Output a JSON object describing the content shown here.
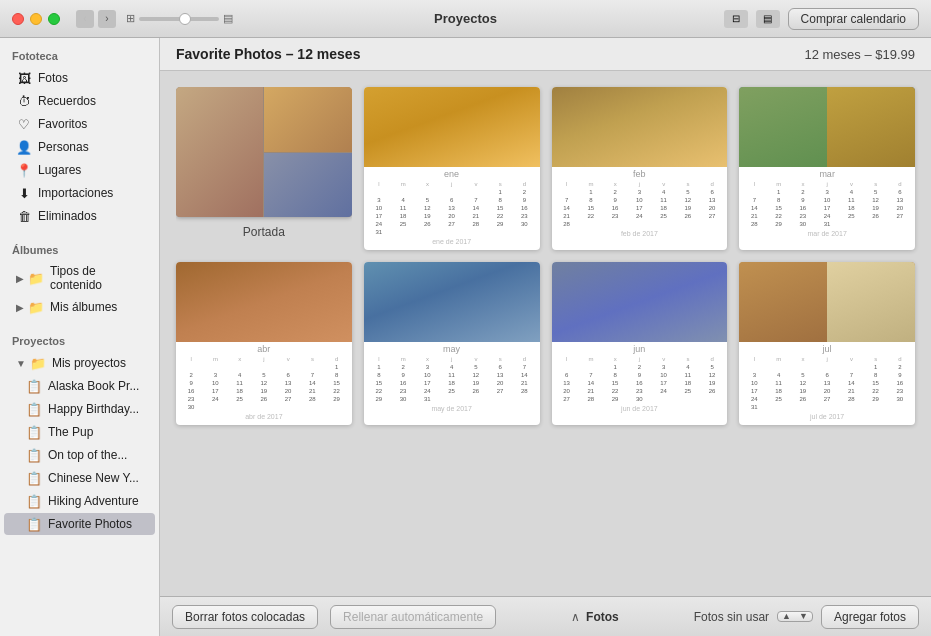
{
  "titlebar": {
    "title": "Proyectos",
    "buy_button": "Comprar calendario"
  },
  "sidebar": {
    "sections": [
      {
        "title": "Fototeca",
        "items": [
          {
            "id": "fotos",
            "label": "Fotos",
            "icon": "🖼",
            "indented": false
          },
          {
            "id": "recuerdos",
            "label": "Recuerdos",
            "icon": "⏱",
            "indented": false
          },
          {
            "id": "favoritos",
            "label": "Favoritos",
            "icon": "♡",
            "indented": false
          },
          {
            "id": "personas",
            "label": "Personas",
            "icon": "👤",
            "indented": false
          },
          {
            "id": "lugares",
            "label": "Lugares",
            "icon": "📍",
            "indented": false
          },
          {
            "id": "importaciones",
            "label": "Importaciones",
            "icon": "⬇",
            "indented": false
          },
          {
            "id": "eliminados",
            "label": "Eliminados",
            "icon": "🗑",
            "indented": false
          }
        ]
      },
      {
        "title": "Álbumes",
        "items": [
          {
            "id": "tipos",
            "label": "Tipos de contenido",
            "icon": "▶",
            "indented": false
          },
          {
            "id": "mis-albumes",
            "label": "Mis álbumes",
            "icon": "▶",
            "indented": false
          }
        ]
      },
      {
        "title": "Proyectos",
        "items": [
          {
            "id": "mis-proyectos",
            "label": "Mis proyectos",
            "icon": "▼",
            "indented": false
          },
          {
            "id": "alaska",
            "label": "Alaska Book Pr...",
            "icon": "📋",
            "indented": true
          },
          {
            "id": "birthday",
            "label": "Happy Birthday...",
            "icon": "📋",
            "indented": true
          },
          {
            "id": "pup",
            "label": "The Pup",
            "icon": "📋",
            "indented": true
          },
          {
            "id": "ontop",
            "label": "On top of the...",
            "icon": "📋",
            "indented": true
          },
          {
            "id": "chinese",
            "label": "Chinese New Y...",
            "icon": "📋",
            "indented": true
          },
          {
            "id": "hiking",
            "label": "Hiking Adventure",
            "icon": "📋",
            "indented": true
          },
          {
            "id": "favorite",
            "label": "Favorite Photos",
            "icon": "📋",
            "indented": true,
            "selected": true
          }
        ]
      }
    ]
  },
  "content": {
    "header_title": "Favorite Photos – 12 meses",
    "header_price": "12 meses – $19.99",
    "cover_label": "Portada"
  },
  "calendar_pages": [
    {
      "id": "cover",
      "type": "cover",
      "label": "Portada"
    },
    {
      "id": "jan",
      "type": "month",
      "month": "ene de 2017",
      "photo_type": "dog1"
    },
    {
      "id": "feb",
      "type": "month",
      "month": "feb de 2017",
      "photo_type": "dog2"
    },
    {
      "id": "mar",
      "type": "month",
      "month": "mar de 2017",
      "photo_type": "dog3"
    },
    {
      "id": "apr",
      "type": "month",
      "month": "abr de 2017",
      "photo_type": "dog4"
    },
    {
      "id": "may",
      "type": "month",
      "month": "may de 2017",
      "photo_type": "girl1"
    },
    {
      "id": "jun",
      "type": "month",
      "month": "jun de 2017",
      "photo_type": "dog5"
    },
    {
      "id": "jul",
      "type": "month",
      "month": "jul de 2017",
      "photo_type": "dog6"
    }
  ],
  "bottom": {
    "delete_btn": "Borrar fotos colocadas",
    "refill_btn": "Rellenar automáticamente",
    "photos_label": "Fotos",
    "unused_label": "Fotos sin usar",
    "add_photos_btn": "Agregar fotos"
  },
  "colors": {
    "selected_sidebar": "#c8c8c8",
    "accent": "#0070c9"
  }
}
